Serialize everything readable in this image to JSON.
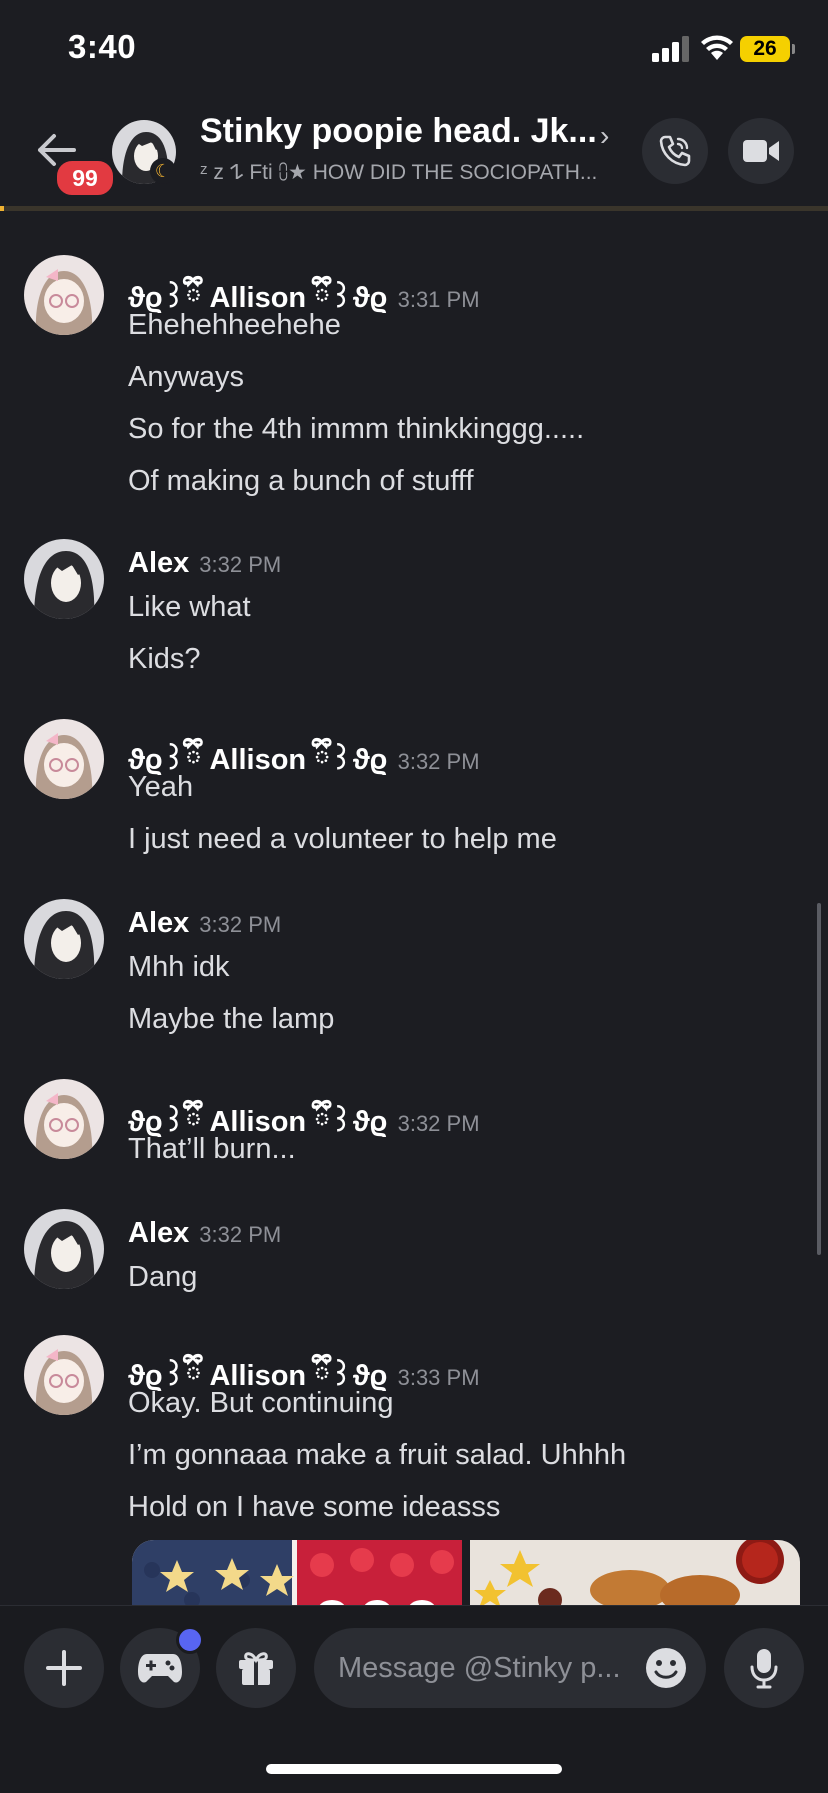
{
  "status_bar": {
    "time": "3:40",
    "battery": "26"
  },
  "header": {
    "badge_count": "99",
    "title": "Stinky poopie head. Jk...",
    "subtitle": "ᶻ z 𐰁 Fti ⩇★ HOW DID THE SOCIOPATH..."
  },
  "messages": [
    {
      "name": "ϑϱ꒱ྀི Allison ྀི꒱ϑϱ",
      "time": "3:31 PM",
      "avatar": "allison",
      "lines": [
        "Ehehehheehehe",
        "Anyways",
        "So for the 4th immm thinkkinggg.....",
        "Of making a bunch of stufff"
      ]
    },
    {
      "name": "Alex",
      "time": "3:32 PM",
      "avatar": "alex",
      "lines": [
        "Like what",
        "Kids?"
      ]
    },
    {
      "name": "ϑϱ꒱ྀི Allison ྀི꒱ϑϱ",
      "time": "3:32 PM",
      "avatar": "allison",
      "lines": [
        "Yeah",
        "I just need a volunteer to help me"
      ]
    },
    {
      "name": "Alex",
      "time": "3:32 PM",
      "avatar": "alex",
      "lines": [
        "Mhh idk",
        "Maybe the lamp"
      ]
    },
    {
      "name": "ϑϱ꒱ྀི Allison ྀི꒱ϑϱ",
      "time": "3:32 PM",
      "avatar": "allison",
      "lines": [
        "That’ll burn..."
      ]
    },
    {
      "name": "Alex",
      "time": "3:32 PM",
      "avatar": "alex",
      "lines": [
        "Dang"
      ]
    },
    {
      "name": "ϑϱ꒱ྀི Allison ྀི꒱ϑϱ",
      "time": "3:33 PM",
      "avatar": "allison",
      "lines": [
        "Okay. But continuing",
        "I’m gonnaaa make a fruit salad. Uhhhh",
        "Hold on I have some ideasss"
      ]
    }
  ],
  "composer": {
    "placeholder": "Message @Stinky p..."
  },
  "colors": {
    "background": "#1c1d22",
    "accent_badge": "#e23a41",
    "notification_dot": "#5865f2",
    "battery": "#f5d000"
  }
}
